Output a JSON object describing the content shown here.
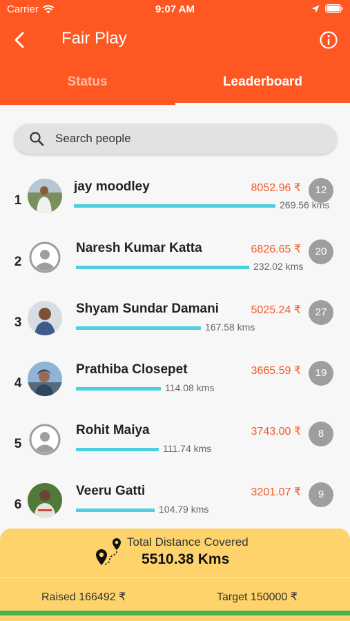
{
  "status_bar": {
    "carrier": "Carrier",
    "time": "9:07 AM"
  },
  "app_bar": {
    "title": "Fair Play"
  },
  "tabs": [
    {
      "label": "Status"
    },
    {
      "label": "Leaderboard"
    }
  ],
  "search": {
    "placeholder": "Search people"
  },
  "leaderboard": [
    {
      "rank": "1",
      "name": "jay moodley",
      "amount": "8052.96 ₹",
      "badge": "12",
      "distance": "269.56 kms",
      "progress": 1.0,
      "avatar": "photo"
    },
    {
      "rank": "2",
      "name": "Naresh Kumar Katta",
      "amount": "6826.65 ₹",
      "badge": "20",
      "distance": "232.02 kms",
      "progress": 0.86,
      "avatar": "placeholder"
    },
    {
      "rank": "3",
      "name": "Shyam Sundar Damani",
      "amount": "5025.24 ₹",
      "badge": "27",
      "distance": "167.58 kms",
      "progress": 0.62,
      "avatar": "photo"
    },
    {
      "rank": "4",
      "name": "Prathiba Closepet",
      "amount": "3665.59 ₹",
      "badge": "19",
      "distance": "114.08 kms",
      "progress": 0.42,
      "avatar": "photo"
    },
    {
      "rank": "5",
      "name": "Rohit Maiya",
      "amount": "3743.00 ₹",
      "badge": "8",
      "distance": "111.74 kms",
      "progress": 0.41,
      "avatar": "placeholder"
    },
    {
      "rank": "6",
      "name": "Veeru Gatti",
      "amount": "3201.07 ₹",
      "badge": "9",
      "distance": "104.79 kms",
      "progress": 0.39,
      "avatar": "photo"
    }
  ],
  "footer": {
    "total_label": "Total Distance Covered",
    "total_value": "5510.38 Kms",
    "raised": "Raised 166492 ₹",
    "target": "Target 150000 ₹"
  },
  "colors": {
    "header": "#ff5722",
    "amount": "#f05a28",
    "bar": "#4cd0e1",
    "footer": "#ffd36b",
    "footer_strip": "#4caf50"
  },
  "icons": [
    "wifi-icon",
    "location-arrow-icon",
    "battery-icon",
    "back-arrow-icon",
    "info-icon",
    "search-icon",
    "avatar-placeholder-icon",
    "route-map-icon"
  ]
}
